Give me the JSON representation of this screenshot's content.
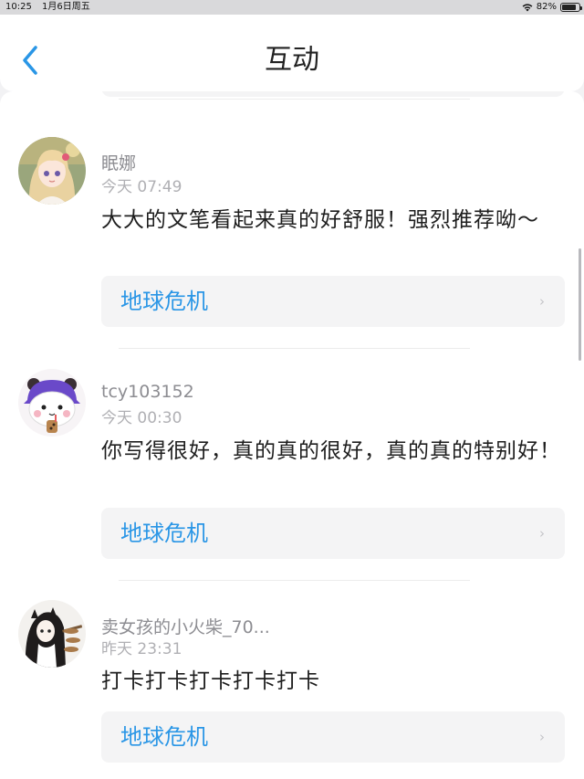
{
  "status_bar": {
    "time": "10:25",
    "date": "1月6日周五",
    "battery_percent": "82%",
    "battery_level": 0.82
  },
  "header": {
    "title": "互动",
    "back_icon": "chevron-left-icon",
    "accent_color": "#2a96e6"
  },
  "comments": [
    {
      "username": "眠娜",
      "time": "今天 07:49",
      "text": "大大的文笔看起来真的好舒服！强烈推荐呦～",
      "book": "地球危机",
      "avatar_icon": "anime-girl-avatar"
    },
    {
      "username": "tcy103152",
      "time": "今天 00:30",
      "text": "你写得很好，真的真的很好，真的真的特别好！",
      "book": "地球危机",
      "avatar_icon": "panda-avatar"
    },
    {
      "username": "卖女孩的小火柴_70...",
      "time": "昨天 23:31",
      "text": "打卡打卡打卡打卡打卡",
      "book": "地球危机",
      "avatar_icon": "cat-girl-avatar"
    }
  ]
}
